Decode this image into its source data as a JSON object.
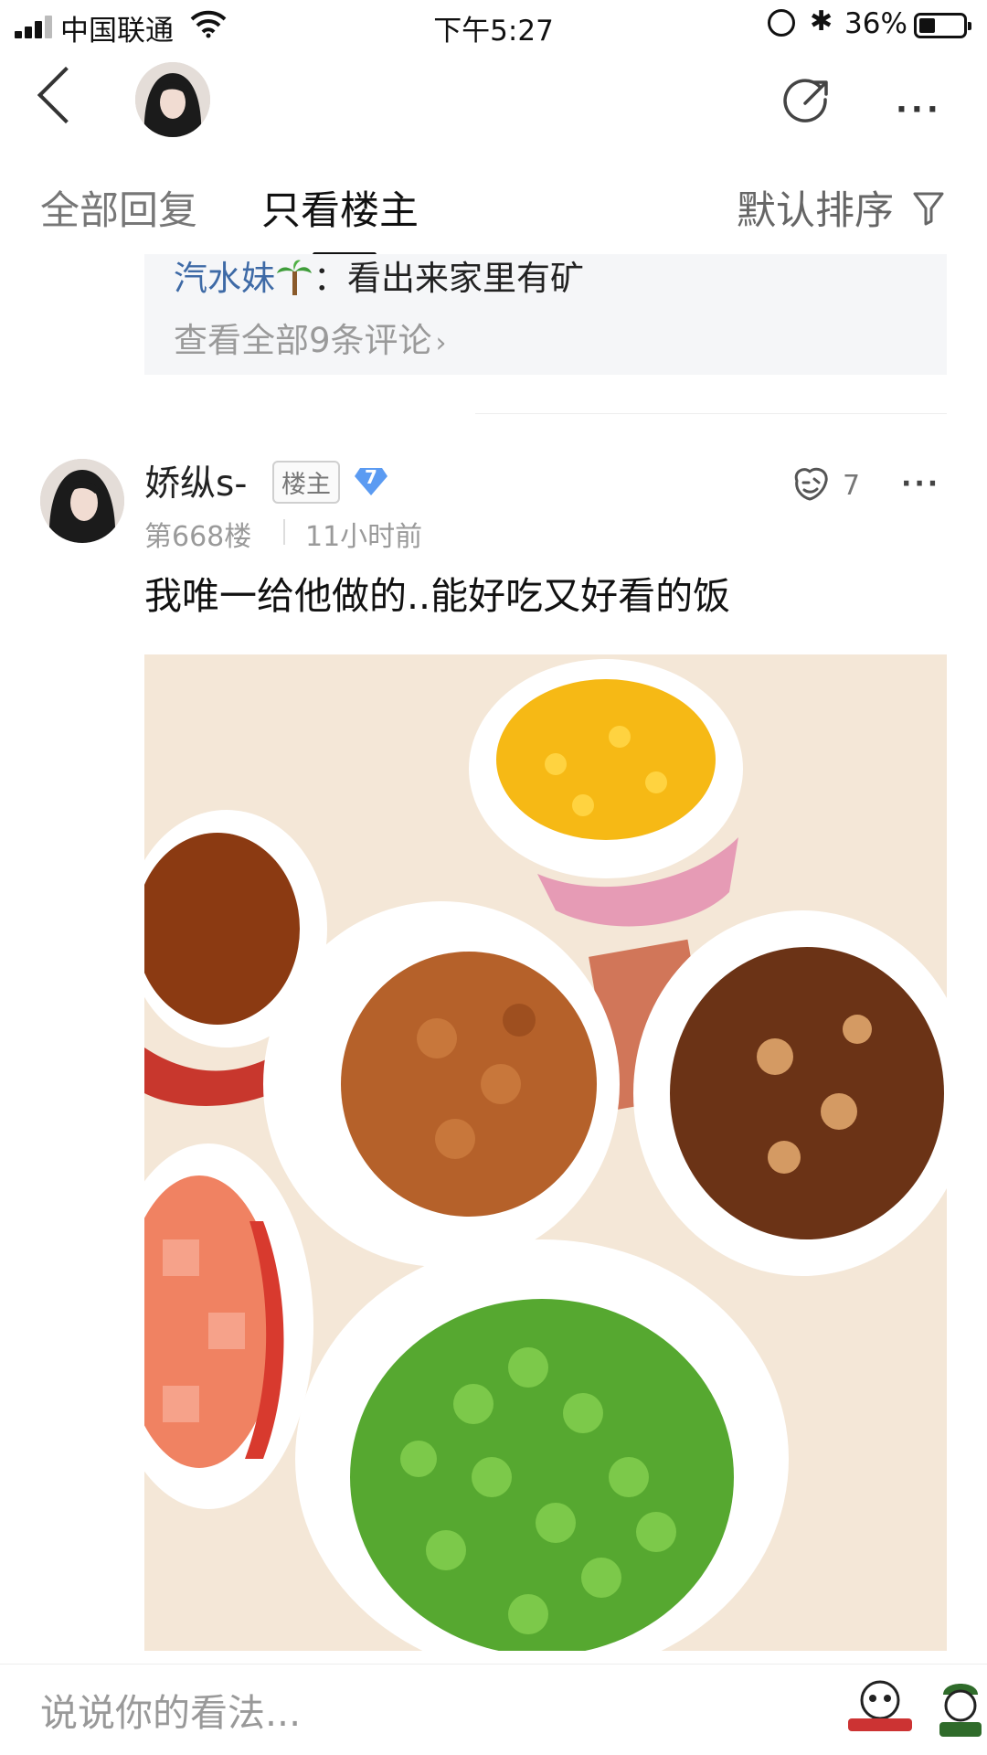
{
  "status_bar": {
    "carrier": "中国联通",
    "time": "下午5:27",
    "bluetooth": "✱",
    "battery_percent": "36%",
    "battery_level": 0.36,
    "signal_bars": 3
  },
  "nav": {
    "back_icon": "chevron-left-icon",
    "share_icon": "share-icon",
    "more_icon": "more-icon",
    "more_label": "···"
  },
  "tabs": {
    "all_replies": "全部回复",
    "owner_only": "只看楼主",
    "sort": "默认排序",
    "active": "owner_only"
  },
  "previous_comment": {
    "user": "汽水妹",
    "separator": "：",
    "text": "看出来家里有矿",
    "view_all": "查看全部9条评论",
    "view_all_arrow": "›"
  },
  "post": {
    "username": "娇纵s-",
    "owner_badge": "楼主",
    "level": "7",
    "floor": "第668楼",
    "time_ago": "11小时前",
    "like_count": "7",
    "more_label": "···",
    "text": "我唯一给他做的..能好吃又好看的饭"
  },
  "footer": {
    "input_placeholder": "说说你的看法..."
  },
  "colors": {
    "link_blue": "#3e6aa6",
    "badge_blue": "#5b9bf2",
    "muted": "#9a9a9a",
    "comment_bg": "#f5f6f8"
  }
}
